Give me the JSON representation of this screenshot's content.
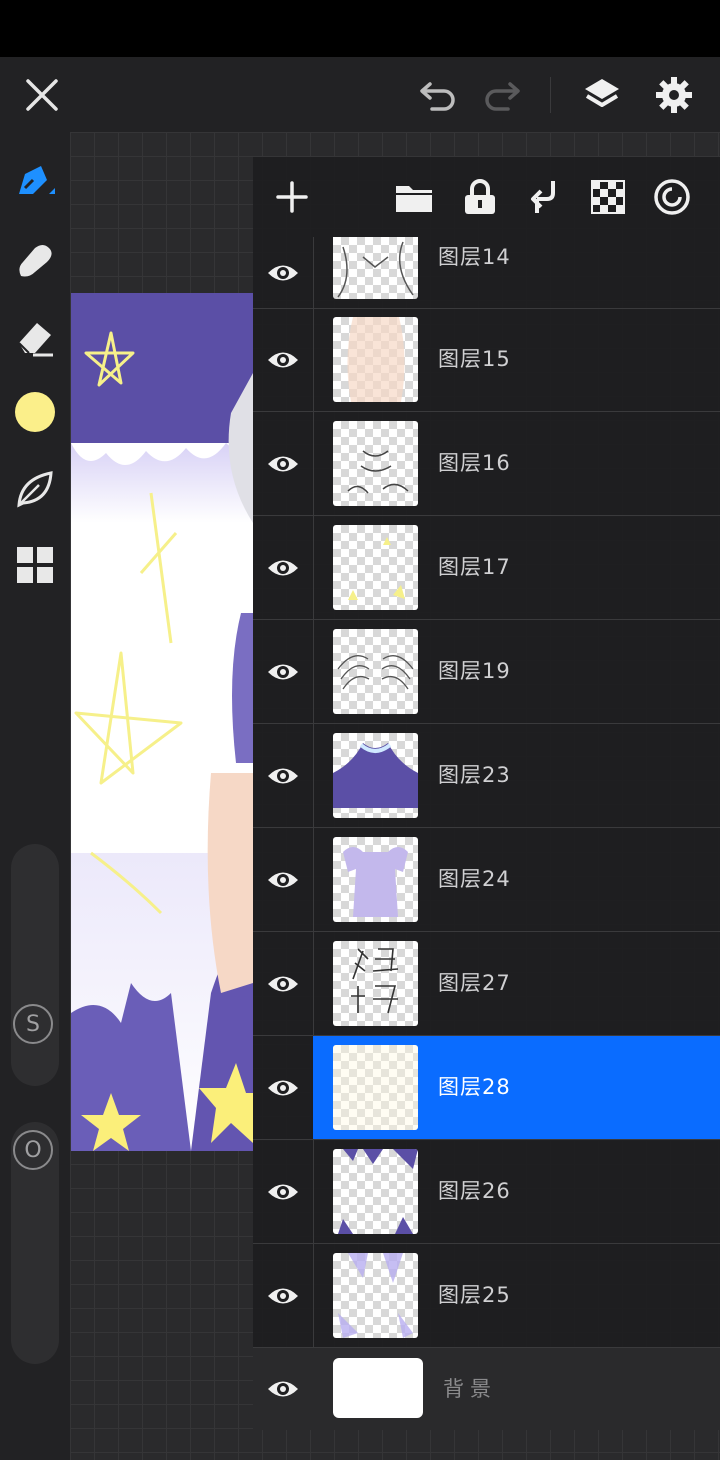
{
  "topbar": {
    "close_icon": "close-icon",
    "undo_icon": "undo-icon",
    "redo_icon": "redo-icon",
    "layers_icon": "layers-icon",
    "settings_icon": "gear-icon"
  },
  "tools": {
    "brush": "brush-icon",
    "smudge": "smudge-icon",
    "eraser": "eraser-icon",
    "color": "#fbef8a",
    "leaf": "leaf-icon",
    "grid": "grid-icon"
  },
  "sliders": {
    "size_label": "S",
    "opacity_label": "O"
  },
  "panel_toolbar": {
    "add": "plus-icon",
    "folder": "folder-icon",
    "lock": "lock-icon",
    "merge": "merge-down-icon",
    "transparency": "checker-icon",
    "blend": "blend-icon"
  },
  "layers": [
    {
      "name": "图层14",
      "selected": false
    },
    {
      "name": "图层15",
      "selected": false
    },
    {
      "name": "图层16",
      "selected": false
    },
    {
      "name": "图层17",
      "selected": false
    },
    {
      "name": "图层19",
      "selected": false
    },
    {
      "name": "图层23",
      "selected": false
    },
    {
      "name": "图层24",
      "selected": false
    },
    {
      "name": "图层27",
      "selected": false
    },
    {
      "name": "图层28",
      "selected": true
    },
    {
      "name": "图层26",
      "selected": false
    },
    {
      "name": "图层25",
      "selected": false
    }
  ],
  "background_layer": {
    "name": "背景"
  },
  "colors": {
    "accent": "#0a6cff",
    "brush_active": "#1e90ff",
    "current_color": "#fbef8a"
  }
}
